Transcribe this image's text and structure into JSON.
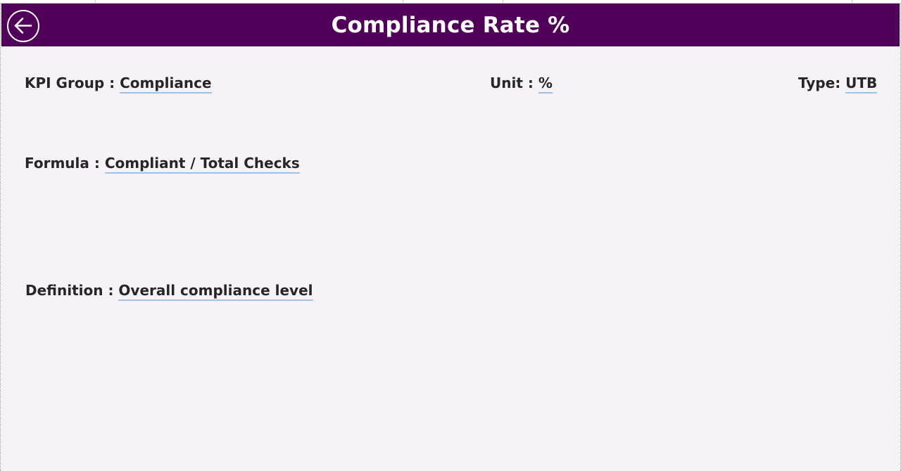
{
  "header": {
    "title": "Compliance Rate %",
    "back_icon": "arrow-left-circle-icon",
    "background": "#500058",
    "text_color": "#ffffff"
  },
  "kpi": {
    "group_label": "KPI Group : ",
    "group_value": "Compliance",
    "unit_label": "Unit : ",
    "unit_value": "%",
    "type_label": "Type: ",
    "type_value": "UTB",
    "formula_label": "Formula : ",
    "formula_value": "Compliant / Total Checks",
    "definition_label": "Definition : ",
    "definition_value": "Overall compliance level"
  },
  "colors": {
    "page_background": "#f6f2f8",
    "underline": "#9cc3e6",
    "text": "#262626"
  }
}
